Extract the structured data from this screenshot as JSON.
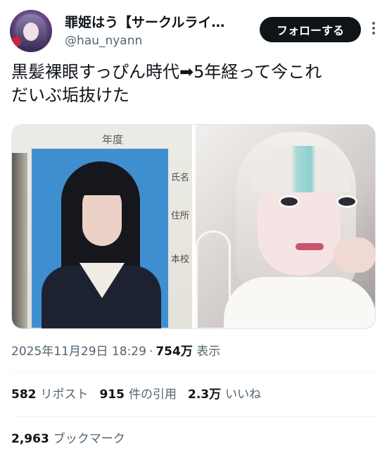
{
  "author": {
    "display_name": "罪姫はう【サークルライ…",
    "handle": "@hau_nyann",
    "follow_label": "フォローする"
  },
  "tweet": {
    "text": "黒髪裸眼すっぴん時代➡5年経って今これ\nだいぶ垢抜けた"
  },
  "media": {
    "left_photo": {
      "year_label": "年度",
      "field_labels": [
        "氏名",
        "住所",
        "本校"
      ]
    },
    "right_photo": {}
  },
  "meta": {
    "timestamp": "2025年11月29日 18:29",
    "separator": "·",
    "views_count": "754万",
    "views_label": "表示"
  },
  "stats": {
    "reposts": {
      "count": "582",
      "label": "リポスト"
    },
    "quotes": {
      "count": "915",
      "label": "件の引用"
    },
    "likes": {
      "count": "2.3万",
      "label": "いいね"
    },
    "bookmarks": {
      "count": "2,963",
      "label": "ブックマーク"
    }
  },
  "colors": {
    "text_primary": "#0f1419",
    "text_secondary": "#536471",
    "button_bg": "#0f1419",
    "divider": "#eff3f4"
  },
  "icons": {
    "more": "more-vertical-icon"
  }
}
